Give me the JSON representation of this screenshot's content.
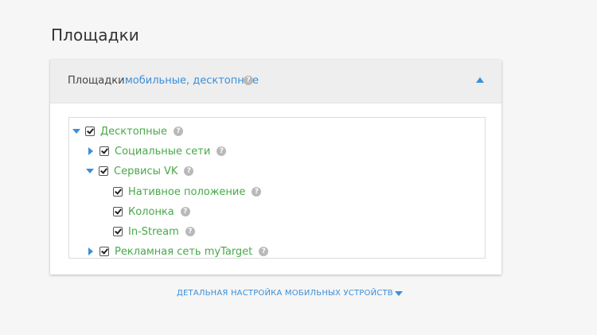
{
  "page": {
    "title": "Площадки"
  },
  "panel": {
    "header_label": "Площадки:",
    "header_value": "мобильные, десктопные",
    "help_glyph": "?",
    "toggle_icon": "chevron-up-icon"
  },
  "tree": {
    "items": [
      {
        "label": "Десктопные",
        "expanded": true,
        "checked": true
      },
      {
        "label": "Социальные сети",
        "expanded": false,
        "checked": true
      },
      {
        "label": "Сервисы VK",
        "expanded": true,
        "checked": true
      },
      {
        "label": "Нативное положение",
        "checked": true
      },
      {
        "label": "Колонка",
        "checked": true
      },
      {
        "label": "In-Stream",
        "checked": true
      },
      {
        "label": "Рекламная сеть myTarget",
        "expanded": false,
        "checked": true
      }
    ]
  },
  "footer": {
    "link_label": "ДЕТАЛЬНАЯ НАСТРОЙКА МОБИЛЬНЫХ УСТРОЙСТВ"
  },
  "colors": {
    "accent": "#3a8fd8",
    "tree_text": "#49a84a",
    "background": "#f6f6f6"
  }
}
